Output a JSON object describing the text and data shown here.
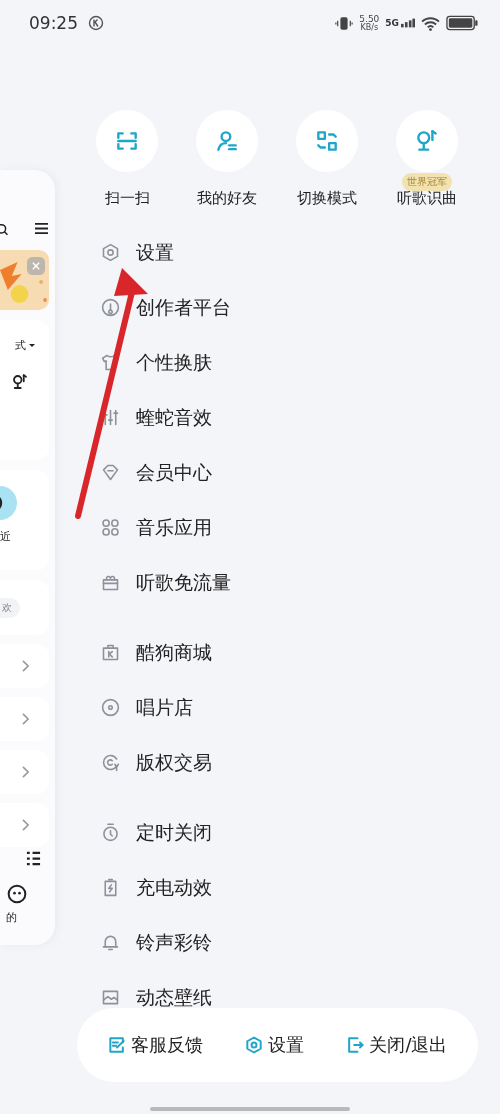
{
  "status_bar": {
    "time": "09:25",
    "net_speed": "5.50",
    "net_unit": "KB/s",
    "network": "5G"
  },
  "quick_actions": [
    {
      "label": "扫一扫",
      "kind": "scan"
    },
    {
      "label": "我的好友",
      "kind": "friends"
    },
    {
      "label": "切换模式",
      "kind": "switch"
    },
    {
      "label": "听歌识曲",
      "kind": "mic",
      "badge": "世界冠军"
    }
  ],
  "menu_groups": [
    [
      {
        "label": "设置",
        "kind": "settings"
      },
      {
        "label": "创作者平台",
        "kind": "creator"
      },
      {
        "label": "个性换肤",
        "kind": "shirt"
      },
      {
        "label": "蝰蛇音效",
        "kind": "sliders"
      },
      {
        "label": "会员中心",
        "kind": "tag"
      },
      {
        "label": "音乐应用",
        "kind": "apps"
      },
      {
        "label": "听歌免流量",
        "kind": "gift"
      }
    ],
    [
      {
        "label": "酷狗商城",
        "kind": "bag"
      },
      {
        "label": "唱片店",
        "kind": "disc"
      },
      {
        "label": "版权交易",
        "kind": "copyright"
      }
    ],
    [
      {
        "label": "定时关闭",
        "kind": "timer"
      },
      {
        "label": "充电动效",
        "kind": "battery"
      },
      {
        "label": "铃声彩铃",
        "kind": "bell"
      },
      {
        "label": "动态壁纸",
        "kind": "wallpaper"
      }
    ]
  ],
  "left_panel": {
    "mode_label": "式",
    "recent_label": "近",
    "like_label": "欢",
    "nav_label": "的"
  },
  "bottom_bar": [
    {
      "label": "客服反馈",
      "kind": "feedback"
    },
    {
      "label": "设置",
      "kind": "settings"
    },
    {
      "label": "关闭/退出",
      "kind": "exit"
    }
  ]
}
